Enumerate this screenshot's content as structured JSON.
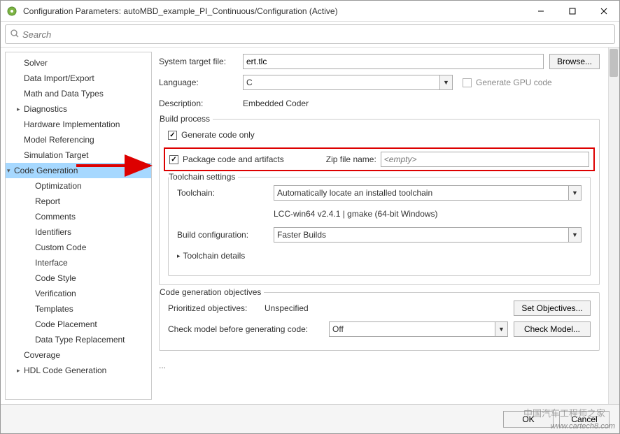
{
  "window": {
    "title": "Configuration Parameters: autoMBD_example_PI_Continuous/Configuration (Active)"
  },
  "search": {
    "placeholder": "Search"
  },
  "nav": {
    "items": [
      {
        "label": "Solver",
        "indent": 1
      },
      {
        "label": "Data Import/Export",
        "indent": 1
      },
      {
        "label": "Math and Data Types",
        "indent": 1
      },
      {
        "label": "Diagnostics",
        "indent": 1,
        "caret": "▸"
      },
      {
        "label": "Hardware Implementation",
        "indent": 1
      },
      {
        "label": "Model Referencing",
        "indent": 1
      },
      {
        "label": "Simulation Target",
        "indent": 1
      },
      {
        "label": "Code Generation",
        "indent": 0,
        "caret": "▾",
        "selected": true
      },
      {
        "label": "Optimization",
        "indent": 2
      },
      {
        "label": "Report",
        "indent": 2
      },
      {
        "label": "Comments",
        "indent": 2
      },
      {
        "label": "Identifiers",
        "indent": 2
      },
      {
        "label": "Custom Code",
        "indent": 2
      },
      {
        "label": "Interface",
        "indent": 2
      },
      {
        "label": "Code Style",
        "indent": 2
      },
      {
        "label": "Verification",
        "indent": 2
      },
      {
        "label": "Templates",
        "indent": 2
      },
      {
        "label": "Code Placement",
        "indent": 2
      },
      {
        "label": "Data Type Replacement",
        "indent": 2
      },
      {
        "label": "Coverage",
        "indent": 1
      },
      {
        "label": "HDL Code Generation",
        "indent": 1,
        "caret": "▸"
      }
    ]
  },
  "form": {
    "target_label": "System target file:",
    "target_value": "ert.tlc",
    "browse": "Browse...",
    "language_label": "Language:",
    "language_value": "C",
    "gpu_label": "Generate GPU code",
    "description_label": "Description:",
    "description_value": "Embedded Coder",
    "build_legend": "Build process",
    "gen_code_only": "Generate code only",
    "package_label": "Package code and artifacts",
    "zip_label": "Zip file name:",
    "zip_placeholder": "<empty>",
    "toolchain_legend": "Toolchain settings",
    "toolchain_label": "Toolchain:",
    "toolchain_value": "Automatically locate an installed toolchain",
    "toolchain_detected": "LCC-win64 v2.4.1 | gmake (64-bit Windows)",
    "build_cfg_label": "Build configuration:",
    "build_cfg_value": "Faster Builds",
    "toolchain_details": "Toolchain details",
    "objectives_legend": "Code generation objectives",
    "prio_label": "Prioritized objectives:",
    "prio_value": "Unspecified",
    "set_obj": "Set Objectives...",
    "check_label": "Check model before generating code:",
    "check_value": "Off",
    "check_model": "Check Model...",
    "ellipsis": "..."
  },
  "footer": {
    "ok": "OK",
    "cancel": "Cancel",
    "watermark": "www.cartech8.com",
    "watermark_cn": "中国汽车工程师之家"
  }
}
